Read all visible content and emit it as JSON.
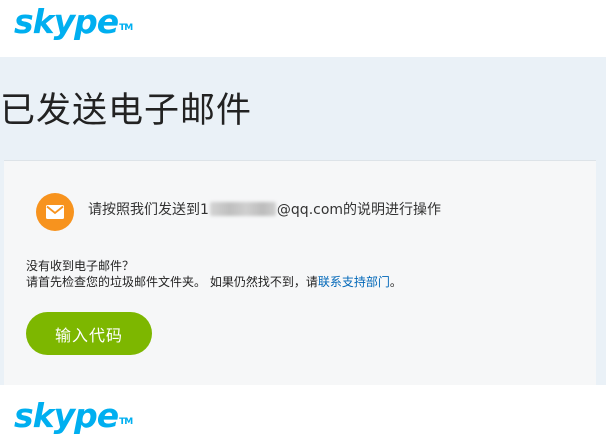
{
  "brand": {
    "logo_text": "skype",
    "tm": "TM",
    "color": "#00aff0"
  },
  "heading": "已发送电子邮件",
  "instruction": {
    "prefix": "请按照我们发送到",
    "masked_char": "1",
    "email_suffix": "@qq.com",
    "suffix": "的说明进行操作"
  },
  "help": {
    "question": "没有收到电子邮件？",
    "advice": "请首先检查您的垃圾邮件文件夹。 如果仍然找不到，请",
    "contact_link": "联系支持部门",
    "end": "。"
  },
  "enter_code_button": "输入代码",
  "colors": {
    "accent_orange": "#f7931e",
    "button_green": "#7db700",
    "link_blue": "#0067b8"
  },
  "icons": {
    "mail": "envelope-icon"
  }
}
